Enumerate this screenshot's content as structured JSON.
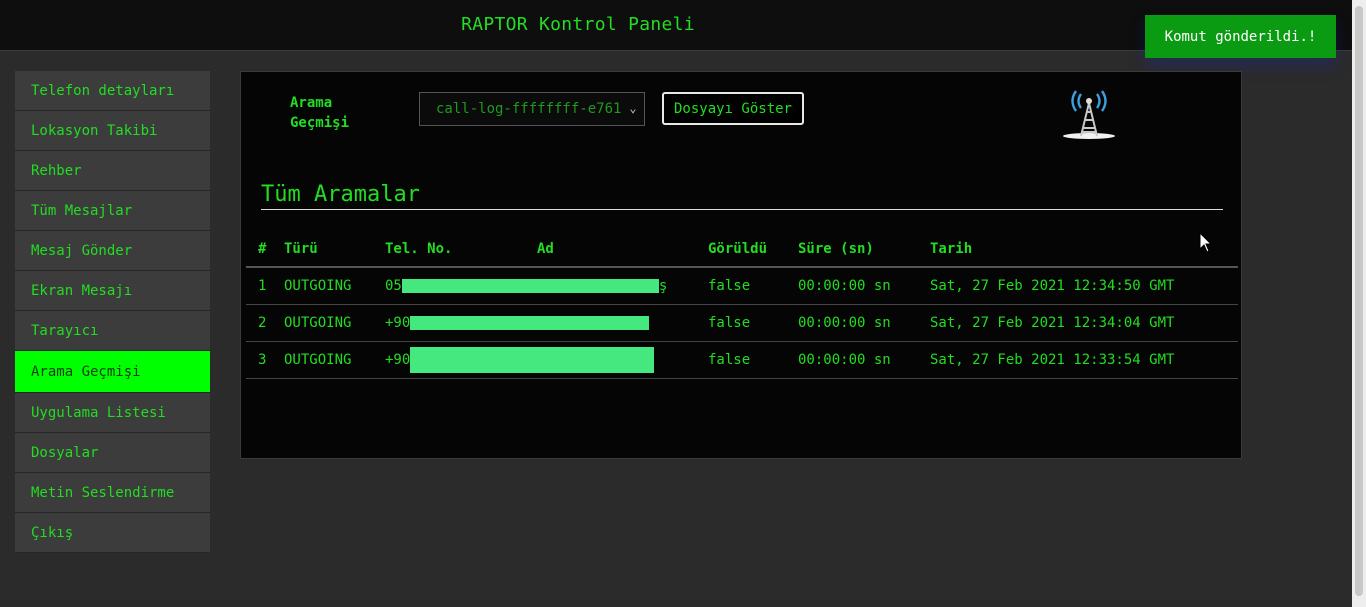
{
  "header": {
    "title": "RAPTOR Kontrol Paneli"
  },
  "toast": {
    "message": "Komut gönderildi.!"
  },
  "sidebar": {
    "items": [
      {
        "label": "Telefon detayları"
      },
      {
        "label": "Lokasyon Takibi"
      },
      {
        "label": "Rehber"
      },
      {
        "label": "Tüm Mesajlar"
      },
      {
        "label": "Mesaj Gönder"
      },
      {
        "label": "Ekran Mesajı"
      },
      {
        "label": "Tarayıcı"
      },
      {
        "label": "Arama Geçmişi",
        "active": true
      },
      {
        "label": "Uygulama Listesi"
      },
      {
        "label": "Dosyalar"
      },
      {
        "label": "Metin Seslendirme"
      },
      {
        "label": "Çıkış"
      }
    ]
  },
  "toolbar": {
    "select_label": "Arama Geçmişi",
    "selected_file": "call-log-ffffffff-e761",
    "show_button": "Dosyayı Göster",
    "tower_icon": "signal-tower-icon"
  },
  "section": {
    "title": "Tüm Aramalar"
  },
  "table": {
    "headers": [
      "#",
      "Türü",
      "Tel. No.",
      "Ad",
      "Görüldü",
      "Süre (sn)",
      "Tarih"
    ],
    "rows": [
      {
        "num": "1",
        "type": "OUTGOING",
        "phone_prefix": "05",
        "phone_suffix": "ş",
        "seen": "false",
        "duration": "00:00:00 sn",
        "date": "Sat, 27 Feb 2021 12:34:50 GMT"
      },
      {
        "num": "2",
        "type": "OUTGOING",
        "phone_prefix": "+90",
        "phone_suffix": "",
        "seen": "false",
        "duration": "00:00:00 sn",
        "date": "Sat, 27 Feb 2021 12:34:04 GMT"
      },
      {
        "num": "3",
        "type": "OUTGOING",
        "phone_prefix": "+90",
        "phone_suffix": "",
        "seen": "false",
        "duration": "00:00:00 sn",
        "date": "Sat, 27 Feb 2021 12:33:54 GMT"
      }
    ]
  },
  "colors": {
    "accent": "#22dd22",
    "active": "#00ff00",
    "toast": "#0a9b12",
    "redaction": "#45e87e"
  }
}
